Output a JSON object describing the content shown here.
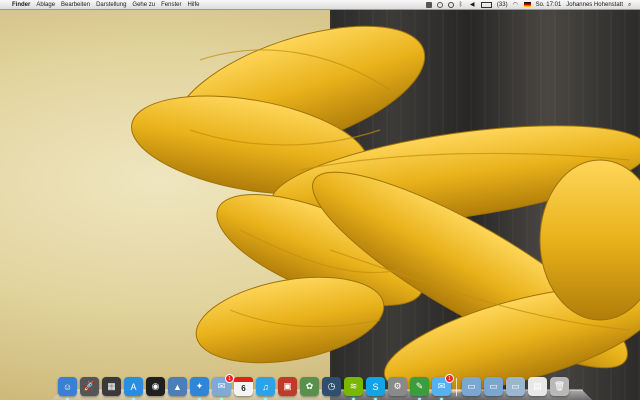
{
  "menubar": {
    "apple_glyph": "",
    "app_name": "Finder",
    "menus": [
      "Ablage",
      "Bearbeiten",
      "Darstellung",
      "Gehe zu",
      "Fenster",
      "Hilfe"
    ],
    "battery": "(33)",
    "clock": "So. 17:01",
    "user": "Johannes Hohenstatt"
  },
  "dock": {
    "calendar_day": "6",
    "mail_badge": "1",
    "messages_badge": "1",
    "apps": [
      {
        "name": "finder-icon",
        "color": "#3a7fd6",
        "glyph": "☺"
      },
      {
        "name": "launchpad-icon",
        "color": "#555",
        "glyph": "🚀"
      },
      {
        "name": "mission-control-icon",
        "color": "#3a3a3a",
        "glyph": "▦"
      },
      {
        "name": "app-store-icon",
        "color": "#2a8ee0",
        "glyph": "A"
      },
      {
        "name": "dashboard-icon",
        "color": "#1f1f1f",
        "glyph": "◉"
      },
      {
        "name": "preview-icon",
        "color": "#4c7fb8",
        "glyph": "▲"
      },
      {
        "name": "safari-icon",
        "color": "#2f86d8",
        "glyph": "✦"
      },
      {
        "name": "mail-icon",
        "color": "#7fa9d6",
        "glyph": "✉"
      },
      {
        "name": "calendar-icon",
        "color": "#f4f4f4",
        "glyph": ""
      },
      {
        "name": "itunes-icon",
        "color": "#2aa3e8",
        "glyph": "♫"
      },
      {
        "name": "photo-booth-icon",
        "color": "#c0392b",
        "glyph": "▣"
      },
      {
        "name": "iphoto-icon",
        "color": "#5a8f4d",
        "glyph": "✿"
      },
      {
        "name": "time-machine-icon",
        "color": "#2f4f6f",
        "glyph": "◷"
      },
      {
        "name": "spotify-icon",
        "color": "#7ab800",
        "glyph": "≋"
      },
      {
        "name": "skype-icon",
        "color": "#14a3e8",
        "glyph": "S"
      },
      {
        "name": "system-preferences-icon",
        "color": "#8a8a8a",
        "glyph": "⚙"
      },
      {
        "name": "evernote-icon",
        "color": "#3c9d3c",
        "glyph": "✎"
      },
      {
        "name": "messages-icon",
        "color": "#57b0ef",
        "glyph": "✉"
      },
      {
        "name": "applications-folder-icon",
        "color": "#7aa6cf",
        "glyph": "▭"
      },
      {
        "name": "documents-folder-icon",
        "color": "#7aa6cf",
        "glyph": "▭"
      },
      {
        "name": "downloads-folder-icon",
        "color": "#9bb6d1",
        "glyph": "▭"
      },
      {
        "name": "stack-icon",
        "color": "#e8e8e8",
        "glyph": "▤"
      },
      {
        "name": "trash-icon",
        "color": "#b8b8b8",
        "glyph": "🗑"
      }
    ]
  },
  "colors": {
    "rope": "#e8b21a",
    "rope_shadow": "#b07d0a",
    "rope_highlight": "#ffd65a"
  }
}
